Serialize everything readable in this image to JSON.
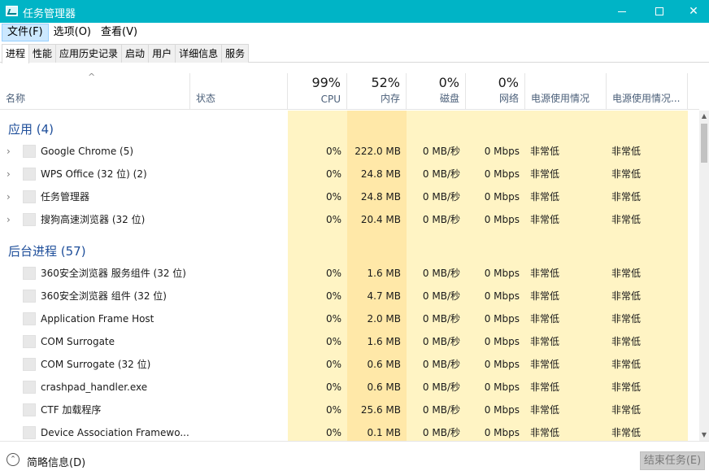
{
  "window": {
    "title": "任务管理器",
    "icon": "task-manager-icon"
  },
  "menu": [
    "文件(F)",
    "选项(O)",
    "查看(V)"
  ],
  "tabs": [
    "进程",
    "性能",
    "应用历史记录",
    "启动",
    "用户",
    "详细信息",
    "服务"
  ],
  "columns": {
    "name": "名称",
    "status": "状态",
    "cpu": {
      "pct": "99%",
      "label": "CPU"
    },
    "memory": {
      "pct": "52%",
      "label": "内存"
    },
    "disk": {
      "pct": "0%",
      "label": "磁盘"
    },
    "network": {
      "pct": "0%",
      "label": "网络"
    },
    "power": "电源使用情况",
    "power_trend": "电源使用情况..."
  },
  "groups": {
    "apps": {
      "title": "应用 (4)",
      "rows": [
        {
          "name": "Google Chrome (5)",
          "cpu": "0%",
          "memory": "222.0 MB",
          "disk": "0 MB/秒",
          "network": "0 Mbps",
          "power": "非常低",
          "power_trend": "非常低"
        },
        {
          "name": "WPS Office (32 位) (2)",
          "cpu": "0%",
          "memory": "24.8 MB",
          "disk": "0 MB/秒",
          "network": "0 Mbps",
          "power": "非常低",
          "power_trend": "非常低"
        },
        {
          "name": "任务管理器",
          "cpu": "0%",
          "memory": "24.8 MB",
          "disk": "0 MB/秒",
          "network": "0 Mbps",
          "power": "非常低",
          "power_trend": "非常低"
        },
        {
          "name": "搜狗高速浏览器 (32 位)",
          "cpu": "0%",
          "memory": "20.4 MB",
          "disk": "0 MB/秒",
          "network": "0 Mbps",
          "power": "非常低",
          "power_trend": "非常低"
        }
      ]
    },
    "background": {
      "title": "后台进程 (57)",
      "rows": [
        {
          "name": "360安全浏览器 服务组件 (32 位)",
          "cpu": "0%",
          "memory": "1.6 MB",
          "disk": "0 MB/秒",
          "network": "0 Mbps",
          "power": "非常低",
          "power_trend": "非常低"
        },
        {
          "name": "360安全浏览器 组件 (32 位)",
          "cpu": "0%",
          "memory": "4.7 MB",
          "disk": "0 MB/秒",
          "network": "0 Mbps",
          "power": "非常低",
          "power_trend": "非常低"
        },
        {
          "name": "Application Frame Host",
          "cpu": "0%",
          "memory": "2.0 MB",
          "disk": "0 MB/秒",
          "network": "0 Mbps",
          "power": "非常低",
          "power_trend": "非常低"
        },
        {
          "name": "COM Surrogate",
          "cpu": "0%",
          "memory": "1.6 MB",
          "disk": "0 MB/秒",
          "network": "0 Mbps",
          "power": "非常低",
          "power_trend": "非常低"
        },
        {
          "name": "COM Surrogate (32 位)",
          "cpu": "0%",
          "memory": "0.6 MB",
          "disk": "0 MB/秒",
          "network": "0 Mbps",
          "power": "非常低",
          "power_trend": "非常低"
        },
        {
          "name": "crashpad_handler.exe",
          "cpu": "0%",
          "memory": "0.6 MB",
          "disk": "0 MB/秒",
          "network": "0 Mbps",
          "power": "非常低",
          "power_trend": "非常低"
        },
        {
          "name": "CTF 加载程序",
          "cpu": "0%",
          "memory": "25.6 MB",
          "disk": "0 MB/秒",
          "network": "0 Mbps",
          "power": "非常低",
          "power_trend": "非常低"
        },
        {
          "name": "Device Association Framewo...",
          "cpu": "0%",
          "memory": "0.1 MB",
          "disk": "0 MB/秒",
          "network": "0 Mbps",
          "power": "非常低",
          "power_trend": "非常低"
        }
      ]
    }
  },
  "footer": {
    "details_label": "简略信息(D)",
    "end_task_label": "结束任务(E)"
  },
  "colors": {
    "titlebar": "#00b4c6",
    "group_title": "#1e4e9a",
    "heat_light": "#fff4c4",
    "heat_mem": "#ffe8a8"
  }
}
